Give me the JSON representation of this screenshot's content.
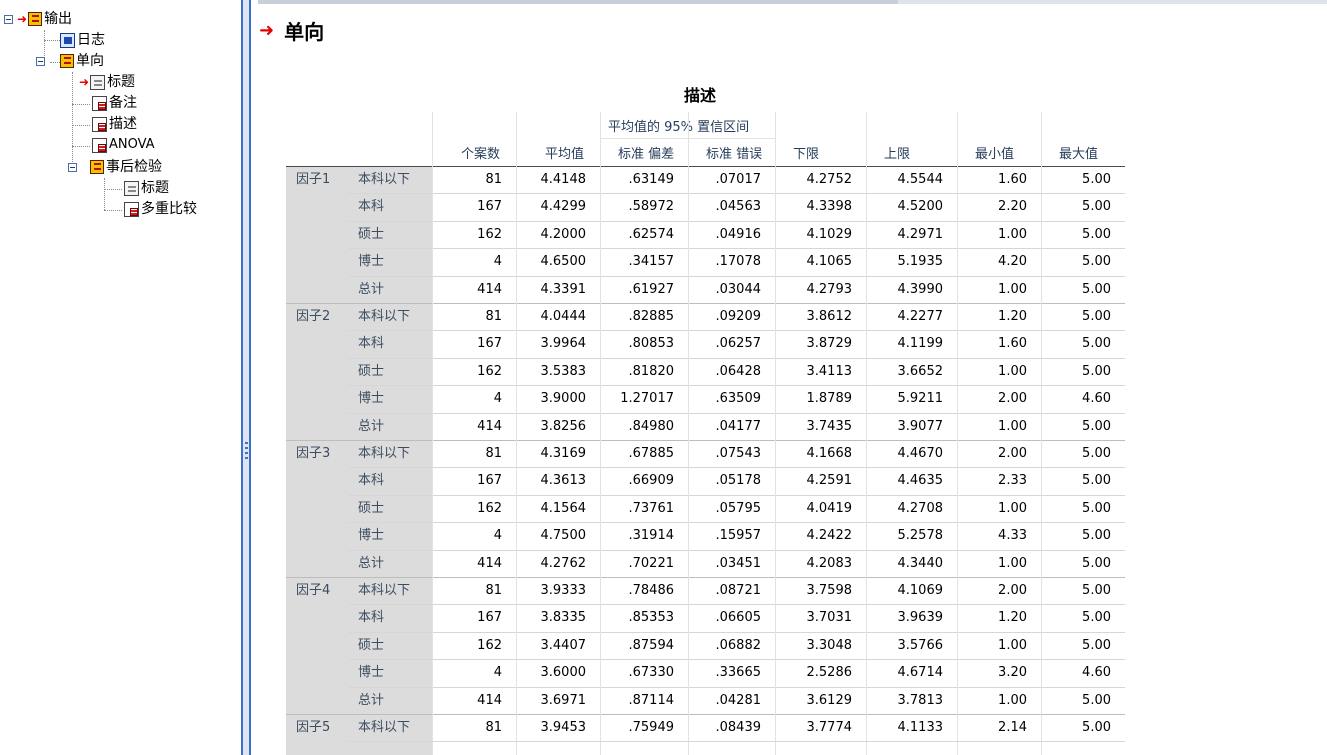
{
  "outline": {
    "root": "输出",
    "log": "日志",
    "oneway": "单向",
    "title_item": "标题",
    "notes": "备注",
    "descriptives": "描述",
    "anova": "ANOVA",
    "posthoc": "事后检验",
    "posthoc_title": "标题",
    "multiple_comparisons": "多重比较"
  },
  "content": {
    "section_title": "单向",
    "table_title": "描述",
    "ci_header": "平均值的 95% 置信区间",
    "columns": [
      "个案数",
      "平均值",
      "标准 偏差",
      "标准 错误",
      "下限",
      "上限",
      "最小值",
      "最大值"
    ]
  },
  "table": {
    "groups": [
      {
        "name": "因子1",
        "rows": [
          [
            "本科以下",
            "81",
            "4.4148",
            ".63149",
            ".07017",
            "4.2752",
            "4.5544",
            "1.60",
            "5.00"
          ],
          [
            "本科",
            "167",
            "4.4299",
            ".58972",
            ".04563",
            "4.3398",
            "4.5200",
            "2.20",
            "5.00"
          ],
          [
            "硕士",
            "162",
            "4.2000",
            ".62574",
            ".04916",
            "4.1029",
            "4.2971",
            "1.00",
            "5.00"
          ],
          [
            "博士",
            "4",
            "4.6500",
            ".34157",
            ".17078",
            "4.1065",
            "5.1935",
            "4.20",
            "5.00"
          ],
          [
            "总计",
            "414",
            "4.3391",
            ".61927",
            ".03044",
            "4.2793",
            "4.3990",
            "1.00",
            "5.00"
          ]
        ]
      },
      {
        "name": "因子2",
        "rows": [
          [
            "本科以下",
            "81",
            "4.0444",
            ".82885",
            ".09209",
            "3.8612",
            "4.2277",
            "1.20",
            "5.00"
          ],
          [
            "本科",
            "167",
            "3.9964",
            ".80853",
            ".06257",
            "3.8729",
            "4.1199",
            "1.60",
            "5.00"
          ],
          [
            "硕士",
            "162",
            "3.5383",
            ".81820",
            ".06428",
            "3.4113",
            "3.6652",
            "1.00",
            "5.00"
          ],
          [
            "博士",
            "4",
            "3.9000",
            "1.27017",
            ".63509",
            "1.8789",
            "5.9211",
            "2.00",
            "4.60"
          ],
          [
            "总计",
            "414",
            "3.8256",
            ".84980",
            ".04177",
            "3.7435",
            "3.9077",
            "1.00",
            "5.00"
          ]
        ]
      },
      {
        "name": "因子3",
        "rows": [
          [
            "本科以下",
            "81",
            "4.3169",
            ".67885",
            ".07543",
            "4.1668",
            "4.4670",
            "2.00",
            "5.00"
          ],
          [
            "本科",
            "167",
            "4.3613",
            ".66909",
            ".05178",
            "4.2591",
            "4.4635",
            "2.33",
            "5.00"
          ],
          [
            "硕士",
            "162",
            "4.1564",
            ".73761",
            ".05795",
            "4.0419",
            "4.2708",
            "1.00",
            "5.00"
          ],
          [
            "博士",
            "4",
            "4.7500",
            ".31914",
            ".15957",
            "4.2422",
            "5.2578",
            "4.33",
            "5.00"
          ],
          [
            "总计",
            "414",
            "4.2762",
            ".70221",
            ".03451",
            "4.2083",
            "4.3440",
            "1.00",
            "5.00"
          ]
        ]
      },
      {
        "name": "因子4",
        "rows": [
          [
            "本科以下",
            "81",
            "3.9333",
            ".78486",
            ".08721",
            "3.7598",
            "4.1069",
            "2.00",
            "5.00"
          ],
          [
            "本科",
            "167",
            "3.8335",
            ".85353",
            ".06605",
            "3.7031",
            "3.9639",
            "1.20",
            "5.00"
          ],
          [
            "硕士",
            "162",
            "3.4407",
            ".87594",
            ".06882",
            "3.3048",
            "3.5766",
            "1.00",
            "5.00"
          ],
          [
            "博士",
            "4",
            "3.6000",
            ".67330",
            ".33665",
            "2.5286",
            "4.6714",
            "3.20",
            "4.60"
          ],
          [
            "总计",
            "414",
            "3.6971",
            ".87114",
            ".04281",
            "3.6129",
            "3.7813",
            "1.00",
            "5.00"
          ]
        ]
      },
      {
        "name": "因子5",
        "rows": [
          [
            "本科以下",
            "81",
            "3.9453",
            ".75949",
            ".08439",
            "3.7774",
            "4.1133",
            "2.14",
            "5.00"
          ]
        ]
      }
    ]
  }
}
